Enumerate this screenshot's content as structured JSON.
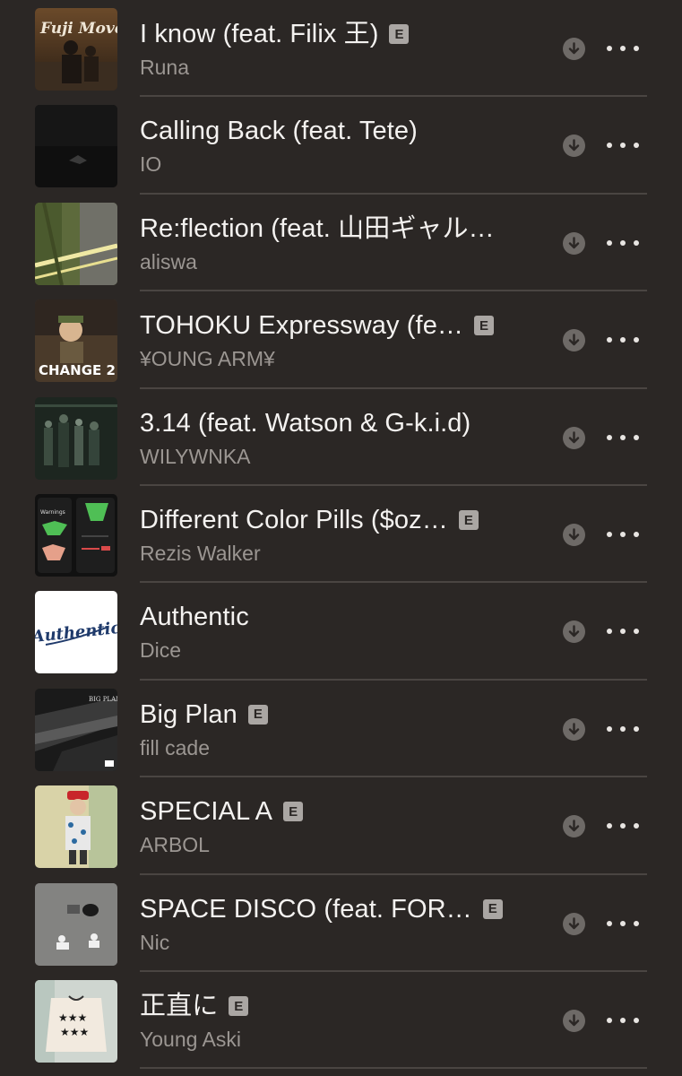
{
  "tracks": [
    {
      "title": "I know (feat. Filix 王)",
      "artist": "Runa",
      "explicit": true,
      "explicit_label": "E",
      "art_icon": "album-art-fuji-move",
      "art_text": "Fuji Move"
    },
    {
      "title": "Calling Back (feat. Tete)",
      "artist": "IO",
      "explicit": false,
      "art_icon": "album-art-calling-back"
    },
    {
      "title": "Re:flection (feat. 山田ギャル…",
      "artist": "aliswa",
      "explicit": false,
      "art_icon": "album-art-reflection"
    },
    {
      "title": "TOHOKU Expressway (fe…",
      "artist": "¥OUNG ARM¥",
      "explicit": true,
      "explicit_label": "E",
      "art_icon": "album-art-change-2",
      "art_text": "CHANGE 2"
    },
    {
      "title": "3.14 (feat. Watson & G-k.i.d)",
      "artist": "WILYWNKA",
      "explicit": false,
      "art_icon": "album-art-3-14"
    },
    {
      "title": "Different Color Pills ($oz…",
      "artist": "Rezis Walker",
      "explicit": true,
      "explicit_label": "E",
      "art_icon": "album-art-different-color-pills",
      "art_text": "Warnings"
    },
    {
      "title": "Authentic",
      "artist": "Dice",
      "explicit": false,
      "art_icon": "album-art-authentic",
      "art_text": "Authentic"
    },
    {
      "title": "Big Plan",
      "artist": "fill cade",
      "explicit": true,
      "explicit_label": "E",
      "art_icon": "album-art-big-plan",
      "art_text": "BIG PLAN"
    },
    {
      "title": "SPECIAL A",
      "artist": "ARBOL",
      "explicit": true,
      "explicit_label": "E",
      "art_icon": "album-art-special-a"
    },
    {
      "title": "SPACE DISCO (feat. FOR…",
      "artist": "Nic",
      "explicit": true,
      "explicit_label": "E",
      "art_icon": "album-art-space-disco"
    },
    {
      "title": "正直に",
      "artist": "Young Aski",
      "explicit": true,
      "explicit_label": "E",
      "art_icon": "album-art-shoujiki-ni"
    }
  ],
  "colors": {
    "background": "#2b2725",
    "title": "#f4f2f0",
    "artist": "#9b9692",
    "separator": "#4a4542",
    "download_circle": "#6e6a67",
    "explicit_badge": "#aaa6a3"
  },
  "icons": {
    "download": "download-arrow-icon",
    "more": "more-options-icon"
  }
}
